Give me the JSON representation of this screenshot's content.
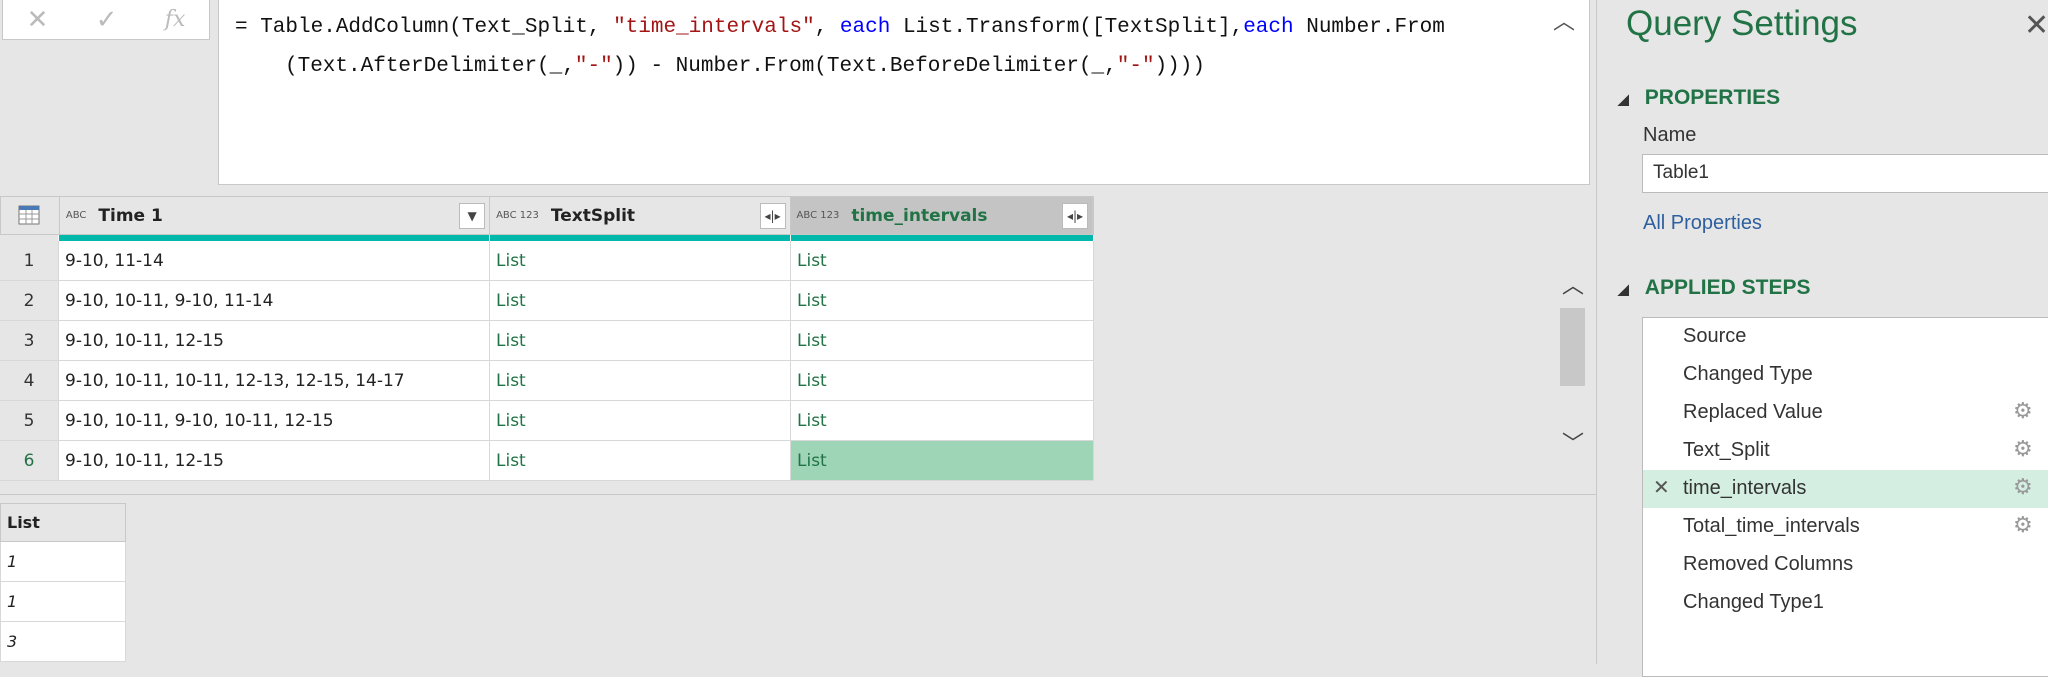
{
  "formula_bar": {
    "cancel": "✕",
    "commit": "✓",
    "fx": "fx",
    "line1": [
      {
        "t": "= Table.AddColumn(Text_Split, ",
        "c": ""
      },
      {
        "t": "\"time_intervals\"",
        "c": "str"
      },
      {
        "t": ", ",
        "c": ""
      },
      {
        "t": "each",
        "c": "kw"
      },
      {
        "t": " List.Transform([TextSplit],",
        "c": ""
      },
      {
        "t": "each",
        "c": "kw"
      },
      {
        "t": " Number.From",
        "c": ""
      }
    ],
    "line2": [
      {
        "t": "(Text.AfterDelimiter(_,",
        "c": ""
      },
      {
        "t": "\"-\"",
        "c": "str"
      },
      {
        "t": ")) - Number.From(Text.BeforeDelimiter(_,",
        "c": ""
      },
      {
        "t": "\"-\"",
        "c": "str"
      },
      {
        "t": "))))",
        "c": ""
      }
    ]
  },
  "grid": {
    "columns": [
      {
        "name": "Time 1",
        "type": "ABC"
      },
      {
        "name": "TextSplit",
        "type": "ABC 123"
      },
      {
        "name": "time_intervals",
        "type": "ABC 123"
      }
    ],
    "rows": [
      [
        "1",
        "9-10, 11-14",
        "List",
        "List"
      ],
      [
        "2",
        "9-10, 10-11, 9-10, 11-14",
        "List",
        "List"
      ],
      [
        "3",
        "9-10, 10-11, 12-15",
        "List",
        "List"
      ],
      [
        "4",
        "9-10, 10-11, 10-11, 12-13, 12-15, 14-17",
        "List",
        "List"
      ],
      [
        "5",
        "9-10, 10-11, 9-10, 10-11, 12-15",
        "List",
        "List"
      ],
      [
        "6",
        "9-10, 10-11, 12-15",
        "List",
        "List"
      ]
    ]
  },
  "preview": {
    "header": "List",
    "values": [
      "1",
      "1",
      "3"
    ]
  },
  "panel": {
    "title": "Query Settings",
    "properties": "PROPERTIES",
    "name_label": "Name",
    "name_value": "Table1",
    "all_properties": "All Properties",
    "applied_steps": "APPLIED STEPS",
    "steps": [
      {
        "label": "Source",
        "gear": false
      },
      {
        "label": "Changed Type",
        "gear": false
      },
      {
        "label": "Replaced Value",
        "gear": true
      },
      {
        "label": "Text_Split",
        "gear": true
      },
      {
        "label": "time_intervals",
        "gear": true,
        "selected": true
      },
      {
        "label": "Total_time_intervals",
        "gear": true
      },
      {
        "label": "Removed Columns",
        "gear": false
      },
      {
        "label": "Changed Type1",
        "gear": false
      }
    ]
  },
  "colors": {
    "accent": "#217346",
    "teal": "#01b8aa",
    "selected_cell": "#9fd5b7",
    "selected_step": "#d4efe1"
  }
}
